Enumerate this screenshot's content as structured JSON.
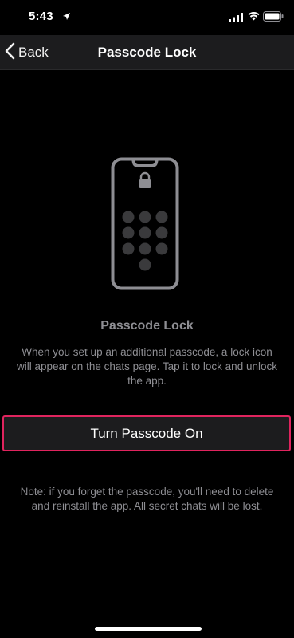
{
  "status_bar": {
    "time": "5:43",
    "icons": [
      "location-arrow-icon",
      "signal-bars-icon",
      "wifi-icon",
      "battery-icon"
    ]
  },
  "nav": {
    "back_label": "Back",
    "title": "Passcode Lock"
  },
  "illustration": {
    "icon": "phone-passcode-icon",
    "lock_icon": "lock-icon"
  },
  "content": {
    "section_title": "Passcode Lock",
    "description": "When you set up an additional passcode, a lock icon will appear on the chats page. Tap it to lock and unlock the app.",
    "turn_on_label": "Turn Passcode On",
    "note": "Note: if you forget the passcode, you'll need to delete and reinstall the app. All secret chats will be lost."
  },
  "colors": {
    "background": "#000000",
    "nav_background": "#1c1c1e",
    "secondary_text": "#8e8e93",
    "highlight_border": "#e0245e"
  }
}
